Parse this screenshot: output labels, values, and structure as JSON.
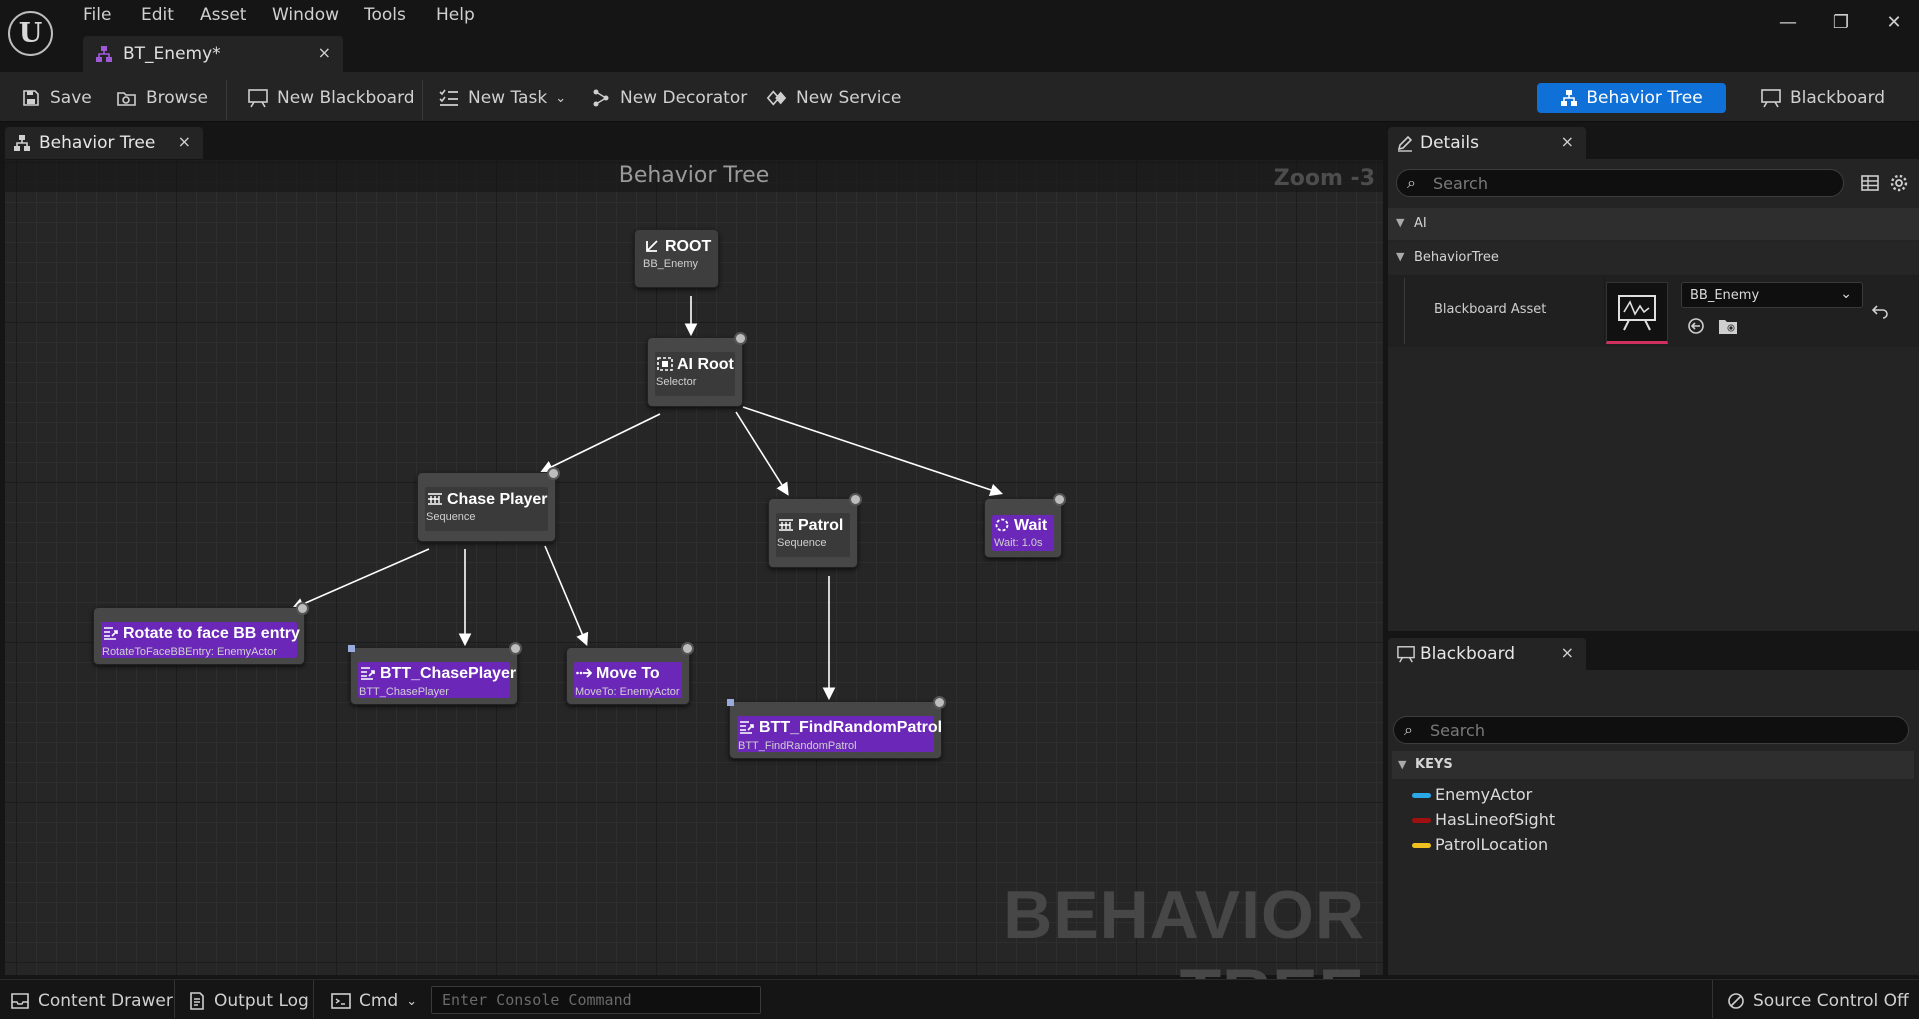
{
  "menu": [
    "File",
    "Edit",
    "Asset",
    "Window",
    "Tools",
    "Help"
  ],
  "document_tab": {
    "label": "BT_Enemy*",
    "close": "×"
  },
  "window_controls": {
    "minimize": "—",
    "restore": "❐",
    "close": "✕"
  },
  "toolbar": {
    "save": "Save",
    "browse": "Browse",
    "new_blackboard": "New Blackboard",
    "new_task": "New Task",
    "new_decorator": "New Decorator",
    "new_service": "New Service"
  },
  "modes": {
    "behavior_tree": "Behavior Tree",
    "blackboard": "Blackboard"
  },
  "graph_tab": {
    "label": "Behavior Tree",
    "close": "×"
  },
  "graph": {
    "title": "Behavior Tree",
    "zoom": "Zoom -3",
    "watermark": "BEHAVIOR TREE",
    "nodes": {
      "root": {
        "title": "ROOT",
        "subtitle": "BB_Enemy"
      },
      "ai_root": {
        "title": "AI Root",
        "subtitle": "Selector"
      },
      "chase_player": {
        "title": "Chase Player",
        "subtitle": "Sequence"
      },
      "patrol": {
        "title": "Patrol",
        "subtitle": "Sequence"
      },
      "wait": {
        "title": "Wait",
        "subtitle": "Wait: 1.0s"
      },
      "rotate": {
        "title": "Rotate to face BB entry",
        "subtitle": "RotateToFaceBBEntry: EnemyActor"
      },
      "btt_chase": {
        "title": "BTT_ChasePlayer",
        "subtitle": "BTT_ChasePlayer"
      },
      "move_to": {
        "title": "Move To",
        "subtitle": "MoveTo: EnemyActor"
      },
      "btt_patrol": {
        "title": "BTT_FindRandomPatrol",
        "subtitle": "BTT_FindRandomPatrol"
      }
    }
  },
  "details": {
    "tab_label": "Details",
    "close": "×",
    "search_placeholder": "Search",
    "categories": [
      "AI",
      "BehaviorTree"
    ],
    "property": {
      "name": "Blackboard Asset",
      "value": "BB_Enemy"
    }
  },
  "blackboard": {
    "tab_label": "Blackboard",
    "close": "×",
    "search_placeholder": "Search",
    "keys_header": "KEYS",
    "keys": [
      {
        "name": "EnemyActor",
        "color": "#2aa8e8"
      },
      {
        "name": "HasLineofSight",
        "color": "#a01010"
      },
      {
        "name": "PatrolLocation",
        "color": "#f0c020"
      }
    ]
  },
  "statusbar": {
    "content_drawer": "Content Drawer",
    "output_log": "Output Log",
    "cmd": "Cmd",
    "console_placeholder": "Enter Console Command",
    "source_control": "Source Control Off"
  },
  "colors": {
    "accent": "#0f70d8",
    "task_node": "#6b28b8",
    "composite_node": "#474747"
  }
}
